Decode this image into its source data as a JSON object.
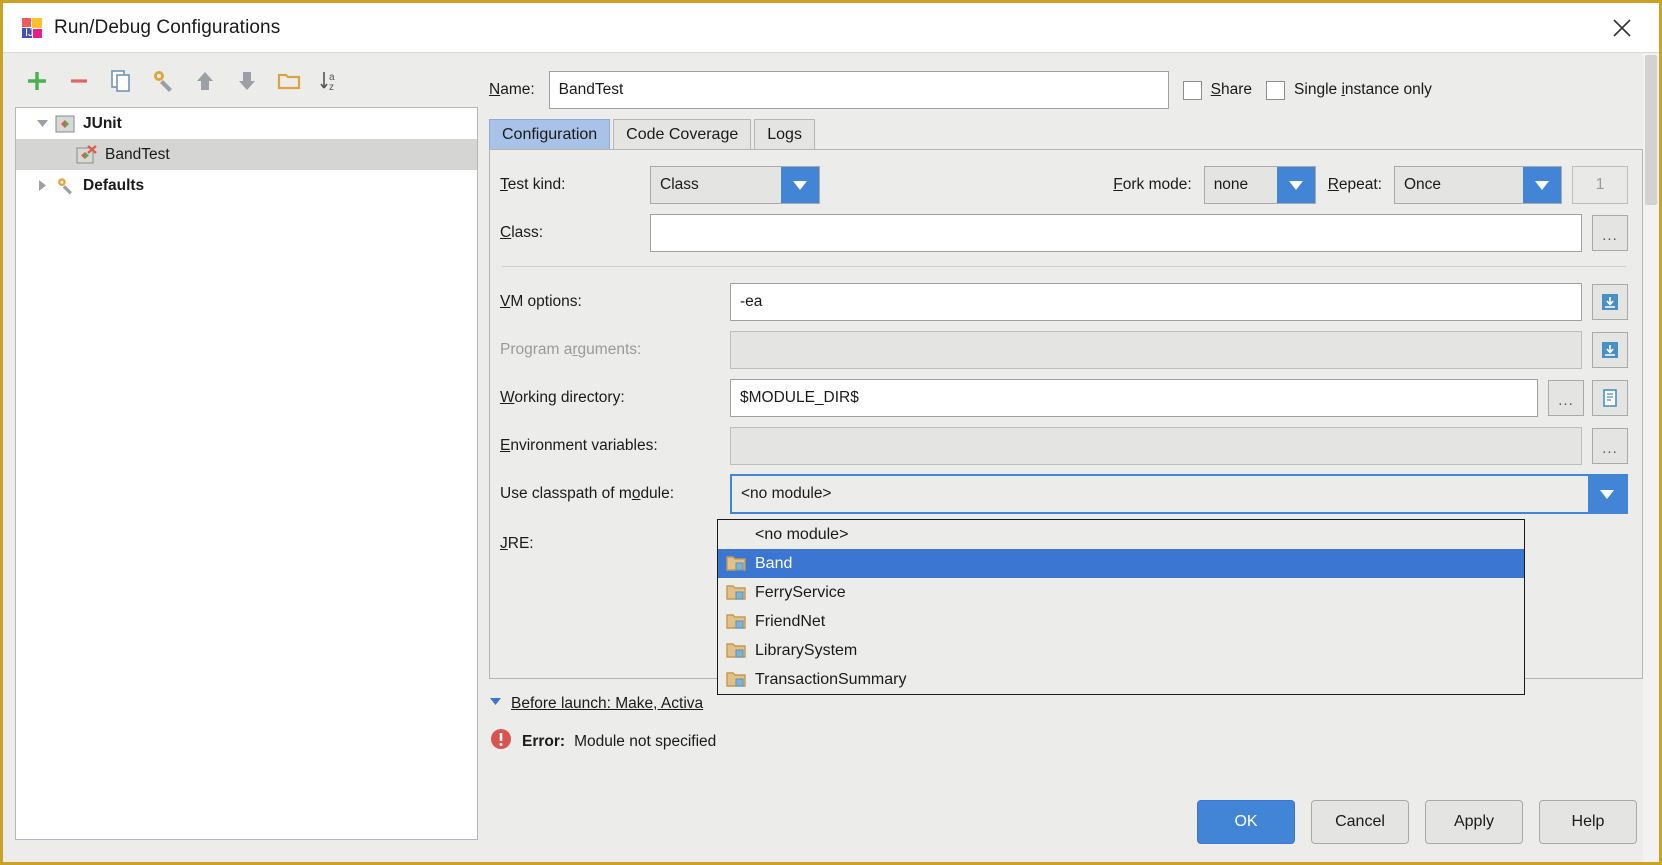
{
  "window": {
    "title": "Run/Debug Configurations",
    "app_icon": "intellij-idea-icon",
    "close_label": "✕"
  },
  "toolbar": {
    "buttons": [
      {
        "name": "add-configuration-button",
        "icon": "plus-icon",
        "enabled": true
      },
      {
        "name": "remove-configuration-button",
        "icon": "minus-icon",
        "enabled": true
      },
      {
        "name": "copy-configuration-button",
        "icon": "copy-icon",
        "enabled": true
      },
      {
        "name": "edit-defaults-button",
        "icon": "wrench-icon",
        "enabled": true
      },
      {
        "name": "move-up-button",
        "icon": "arrow-up-icon",
        "enabled": true
      },
      {
        "name": "move-down-button",
        "icon": "arrow-down-icon",
        "enabled": true
      },
      {
        "name": "create-folder-button",
        "icon": "folder-icon",
        "enabled": true
      },
      {
        "name": "sort-alphabetically-button",
        "icon": "sort-az-icon",
        "enabled": true
      }
    ]
  },
  "tree": {
    "items": [
      {
        "label": "JUnit",
        "icon": "junit-icon",
        "twisty": "expanded",
        "level": 0,
        "selected": false,
        "bold": true
      },
      {
        "label": "BandTest",
        "icon": "junit-error-icon",
        "twisty": "none",
        "level": 1,
        "selected": true,
        "bold": false
      },
      {
        "label": "Defaults",
        "icon": "wrench-icon",
        "twisty": "collapsed",
        "level": 0,
        "selected": false,
        "bold": true
      }
    ]
  },
  "name_row": {
    "label": "Name:",
    "label_mnemonic": "N",
    "value": "BandTest",
    "share": {
      "label": "Share",
      "mnemonic": "S",
      "checked": false
    },
    "single_instance": {
      "label": "Single instance only",
      "mnemonic": "i",
      "checked": false
    }
  },
  "tabs": [
    {
      "label": "Configuration",
      "active": true
    },
    {
      "label": "Code Coverage",
      "active": false
    },
    {
      "label": "Logs",
      "active": false
    }
  ],
  "form": {
    "test_kind": {
      "label": "Test kind:",
      "mnemonic": "T",
      "value": "Class"
    },
    "fork_mode": {
      "label": "Fork mode:",
      "mnemonic": "F",
      "value": "none"
    },
    "repeat": {
      "label": "Repeat:",
      "mnemonic": "R",
      "value": "Once",
      "count": "1",
      "count_enabled": false
    },
    "class": {
      "label": "Class:",
      "mnemonic": "C",
      "value": "",
      "browse": "..."
    },
    "vm_options": {
      "label": "VM options:",
      "mnemonic": "V",
      "value": "-ea",
      "expand_icon": "expand-field-icon"
    },
    "program_arguments": {
      "label": "Program arguments:",
      "mnemonic": "a",
      "value": "",
      "enabled": false,
      "expand_icon": "expand-field-icon"
    },
    "working_directory": {
      "label": "Working directory:",
      "mnemonic": "W",
      "value": "$MODULE_DIR$",
      "browse": "...",
      "macros_icon": "macros-icon"
    },
    "environment_variables": {
      "label": "Environment variables:",
      "mnemonic": "E",
      "value": "",
      "browse": "..."
    },
    "use_classpath": {
      "label": "Use classpath of module:",
      "mnemonic": "o",
      "value": "<no module>",
      "focused": true
    },
    "jre": {
      "label": "JRE:",
      "mnemonic": "J",
      "value": ""
    }
  },
  "module_dropdown": {
    "open": true,
    "items": [
      {
        "label": "<no module>",
        "icon": "none",
        "selected": false
      },
      {
        "label": "Band",
        "icon": "module-folder-icon",
        "selected": true
      },
      {
        "label": "FerryService",
        "icon": "module-folder-icon",
        "selected": false
      },
      {
        "label": "FriendNet",
        "icon": "module-folder-icon",
        "selected": false
      },
      {
        "label": "LibrarySystem",
        "icon": "module-folder-icon",
        "selected": false
      },
      {
        "label": "TransactionSummary",
        "icon": "module-folder-icon",
        "selected": false
      }
    ]
  },
  "before_launch": {
    "label": "Before launch: Make, Activa",
    "mnemonic": "B",
    "twisty": "expanded"
  },
  "error": {
    "icon": "error-icon",
    "prefix": "Error:",
    "message": "Module not specified",
    "color": "#d9534f"
  },
  "buttons": [
    {
      "label": "OK",
      "primary": true,
      "name": "ok-button"
    },
    {
      "label": "Cancel",
      "primary": false,
      "name": "cancel-button"
    },
    {
      "label": "Apply",
      "primary": false,
      "name": "apply-button"
    },
    {
      "label": "Help",
      "primary": false,
      "name": "help-button"
    }
  ],
  "colors": {
    "accent": "#4285d6",
    "selection": "#3a76d2",
    "tab_active": "#a9c3e8",
    "window_border": "#c9a227",
    "error": "#d9534f",
    "folder": "#d9a441"
  }
}
